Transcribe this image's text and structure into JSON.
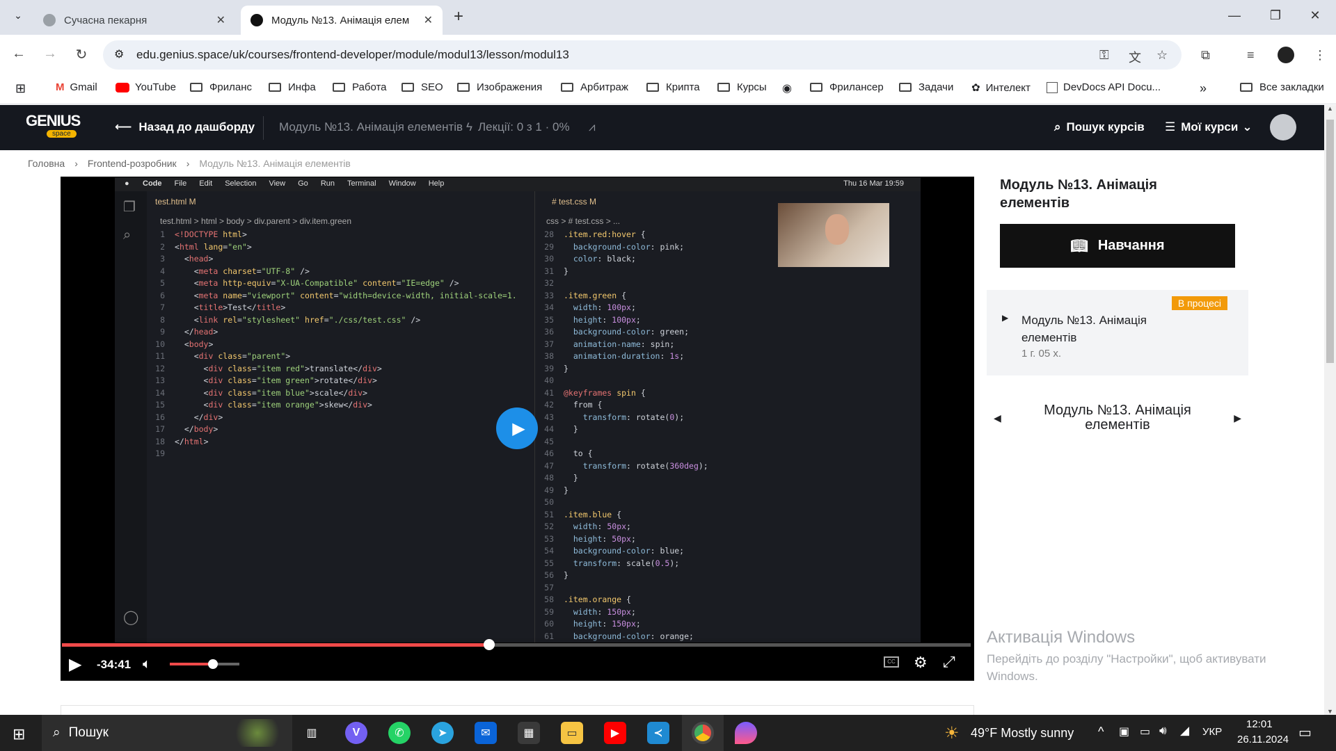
{
  "browser": {
    "tabs": [
      {
        "label": "Сучасна пекарня",
        "active": false
      },
      {
        "label": "Модуль №13. Анімація елем",
        "active": true
      }
    ],
    "url": "edu.genius.space/uk/courses/frontend-developer/module/modul13/lesson/modul13",
    "bookmarks": [
      "Gmail",
      "YouTube",
      "Фриланс",
      "Инфа",
      "Работа",
      "SEO",
      "Изображения",
      "Арбитраж",
      "Крипта",
      "Курсы",
      "Фрилансер",
      "Задачи",
      "Интелект",
      "DevDocs API Docu..."
    ],
    "all_bookmarks": "Все закладки"
  },
  "site": {
    "logo_main": "GENIUS",
    "logo_sub": "space",
    "back": "Назад до дашборду",
    "module": "Модуль №13. Анімація елементів",
    "lectures": "Лекції: 0 з 1 · 0%",
    "search": "Пошук курсів",
    "my_courses": "Мої курси"
  },
  "breadcrumb": [
    "Головна",
    "Frontend-розробник",
    "Модуль №13. Анімація елементів"
  ],
  "video": {
    "mac_menu": [
      "Code",
      "File",
      "Edit",
      "Selection",
      "View",
      "Go",
      "Run",
      "Terminal",
      "Window",
      "Help"
    ],
    "mac_clock": "Thu 16 Mar  19:59",
    "left_tab": "test.html M",
    "right_tab": "# test.css M",
    "left_crumb": "test.html > html > body > div.parent > div.item.green",
    "right_crumb": "css > # test.css > ...",
    "time": "-34:41",
    "progress": 0.47,
    "volume": 0.62
  },
  "panel": {
    "title": "Модуль №13. Анімація елементів",
    "learn": "Навчання",
    "badge": "В процесі",
    "lesson_title": "Модуль №13. Анімація елементів",
    "lesson_duration": "1 г. 05 х.",
    "nav_title": "Модуль №13. Анімація елементів"
  },
  "watermark": {
    "title": "Активація Windows",
    "text": "Перейдіть до розділу \"Настройки\", щоб активувати Windows."
  },
  "taskbar": {
    "search": "Пошук",
    "weather": "49°F  Mostly sunny",
    "lang": "УКР",
    "time": "12:01",
    "date": "26.11.2024"
  }
}
